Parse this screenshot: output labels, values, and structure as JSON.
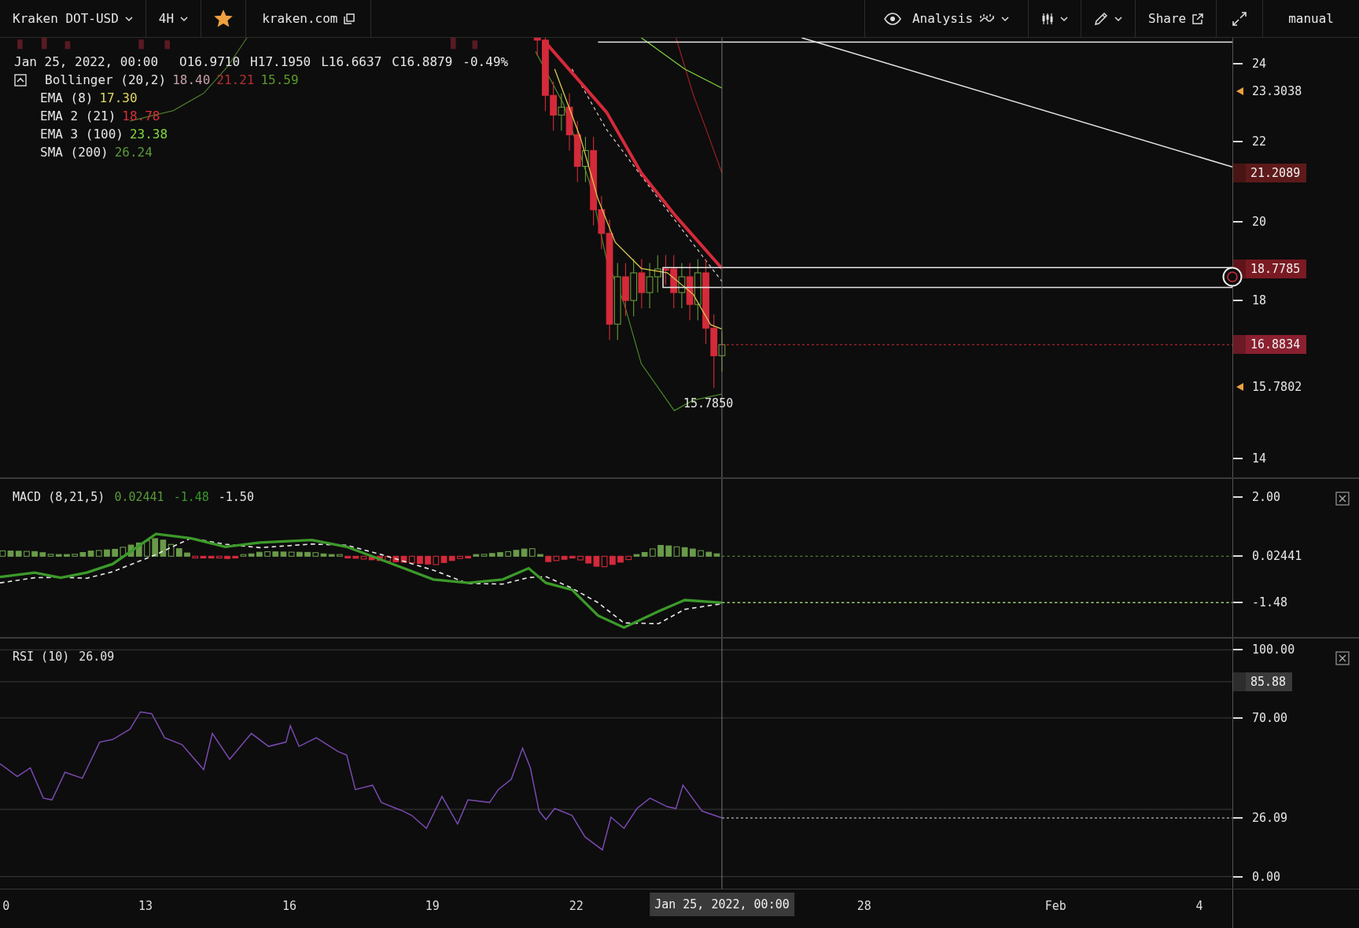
{
  "toolbar": {
    "symbol": "Kraken DOT-USD",
    "interval": "4H",
    "favorite": true,
    "exchange": "kraken.com",
    "analysis": "Analysis",
    "share": "Share",
    "mode": "manual"
  },
  "price_panel": {
    "ohlc": [
      {
        "value": "Jan 25, 2022, 00:00"
      },
      {
        "label": "O",
        "value": "16.9710"
      },
      {
        "label": "H",
        "value": "17.1950"
      },
      {
        "label": "L",
        "value": "16.6637"
      },
      {
        "label": "C",
        "value": "16.8879"
      },
      {
        "value": "-0.49%"
      }
    ],
    "legend_expanded": true,
    "indicators": [
      {
        "name": "Bollinger (20,2)",
        "values": [
          {
            "text": "18.40",
            "color": "#c8a0a8"
          },
          {
            "text": "21.21",
            "color": "#b83030"
          },
          {
            "text": "15.59",
            "color": "#5a9a2a"
          }
        ]
      },
      {
        "name": "EMA (8)",
        "values": [
          {
            "text": "17.30",
            "color": "#e0d860"
          }
        ]
      },
      {
        "name": "EMA 2 (21)",
        "values": [
          {
            "text": "18.78",
            "color": "#d83038"
          }
        ]
      },
      {
        "name": "EMA 3 (100)",
        "values": [
          {
            "text": "23.38",
            "color": "#80d840"
          }
        ]
      },
      {
        "name": "SMA (200)",
        "values": [
          {
            "text": "26.24",
            "color": "#5a9a3a"
          }
        ]
      }
    ],
    "low_label": "15.7850",
    "axis": [
      {
        "kind": "tick",
        "text": "24"
      },
      {
        "kind": "marker",
        "text": "23.3038"
      },
      {
        "kind": "tick",
        "text": "22"
      },
      {
        "kind": "tag",
        "text": "21.2089",
        "color": "#5e1a1a"
      },
      {
        "kind": "tick",
        "text": "20"
      },
      {
        "kind": "tag",
        "text": "18.7785",
        "color": "#7a1a22"
      },
      {
        "kind": "tick",
        "text": "18"
      },
      {
        "kind": "tag",
        "text": "16.8834",
        "color": "#8a2030"
      },
      {
        "kind": "marker",
        "text": "15.7802"
      },
      {
        "kind": "tick",
        "text": "14"
      }
    ]
  },
  "macd_panel": {
    "name": "MACD (8,21,5)",
    "values": [
      {
        "text": "0.02441",
        "color": "#5a9a3a"
      },
      {
        "text": "-1.48",
        "color": "#3a9a2a"
      },
      {
        "text": "-1.50",
        "color": "#e0e0e0"
      }
    ],
    "axis": [
      {
        "kind": "tick",
        "text": "2.00"
      },
      {
        "kind": "tick",
        "text": "0.02441"
      },
      {
        "kind": "tick",
        "text": "-1.48"
      }
    ]
  },
  "rsi_panel": {
    "name": "RSI (10)",
    "values": [
      {
        "text": "26.09",
        "color": "#e0e0e0"
      }
    ],
    "axis": [
      {
        "kind": "tick",
        "text": "100.00"
      },
      {
        "kind": "tag",
        "text": "85.88",
        "color": "#3a3a3a"
      },
      {
        "kind": "tick",
        "text": "70.00"
      },
      {
        "kind": "tick",
        "text": "26.09"
      },
      {
        "kind": "tick",
        "text": "0.00"
      }
    ]
  },
  "time_axis": {
    "labels": [
      "0",
      "13",
      "16",
      "19",
      "22",
      "28",
      "Feb",
      "4"
    ],
    "crosshair": "Jan 25, 2022, 00:00"
  }
}
